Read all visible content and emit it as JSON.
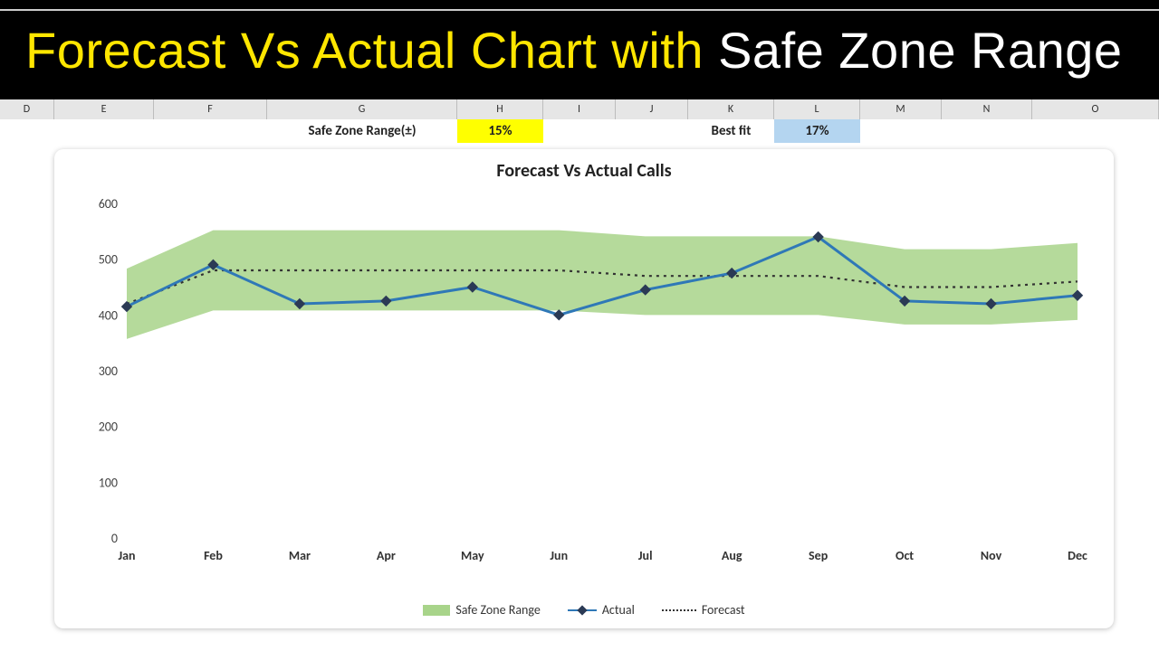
{
  "banner": {
    "part1": "Forecast Vs Actual Chart with ",
    "part2": "Safe Zone Range"
  },
  "column_headers": [
    "D",
    "E",
    "F",
    "G",
    "H",
    "I",
    "J",
    "K",
    "L",
    "M",
    "N",
    "O"
  ],
  "row": {
    "safe_zone_label": "Safe Zone Range(±)",
    "safe_zone_value": "15%",
    "best_fit_label": "Best fit",
    "best_fit_value": "17%"
  },
  "chart": {
    "title": "Forecast Vs Actual Calls",
    "legend": {
      "band": "Safe Zone Range",
      "actual": "Actual",
      "forecast": "Forecast"
    }
  },
  "chart_data": {
    "type": "line",
    "title": "Forecast Vs Actual Calls",
    "xlabel": "",
    "ylabel": "",
    "ylim": [
      0,
      600
    ],
    "y_ticks": [
      0,
      100,
      200,
      300,
      400,
      500,
      600
    ],
    "categories": [
      "Jan",
      "Feb",
      "Mar",
      "Apr",
      "May",
      "Jun",
      "Jul",
      "Aug",
      "Sep",
      "Oct",
      "Nov",
      "Dec"
    ],
    "series": [
      {
        "name": "Actual",
        "type": "line",
        "values": [
          415,
          490,
          420,
          425,
          450,
          400,
          445,
          475,
          540,
          425,
          420,
          435
        ]
      },
      {
        "name": "Forecast",
        "type": "line",
        "style": "dotted",
        "values": [
          420,
          480,
          480,
          480,
          480,
          480,
          470,
          470,
          470,
          450,
          450,
          460
        ]
      },
      {
        "name": "SafeZoneUpper",
        "type": "area_upper",
        "values": [
          483,
          552,
          552,
          552,
          552,
          552,
          541,
          541,
          541,
          518,
          518,
          529
        ]
      },
      {
        "name": "SafeZoneLower",
        "type": "area_lower",
        "values": [
          357,
          408,
          408,
          408,
          408,
          408,
          400,
          400,
          400,
          383,
          383,
          391
        ]
      }
    ],
    "safe_zone_pct": 0.15,
    "best_fit_pct": 0.17
  }
}
